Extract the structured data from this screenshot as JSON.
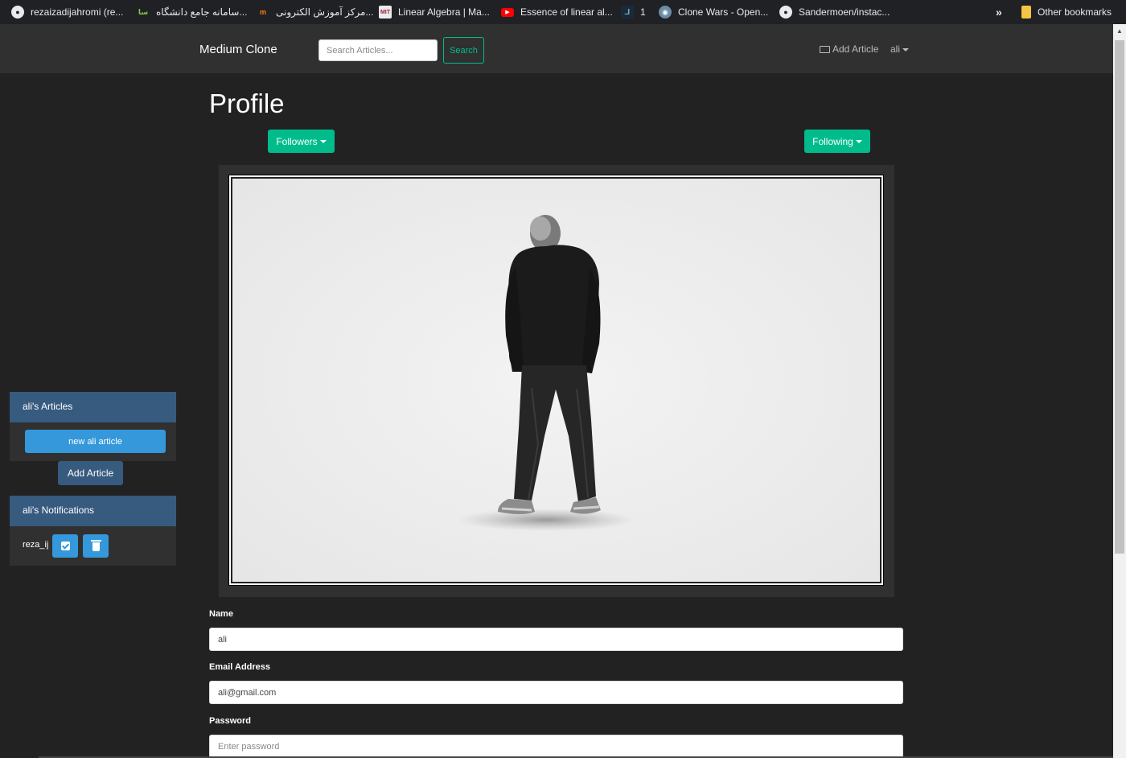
{
  "bookmarks": [
    {
      "label": "rezaizadijahromi (re...",
      "icon": "github-icon"
    },
    {
      "label": "سامانه جامع دانشگاه...",
      "icon": "university-icon",
      "badge": "سا"
    },
    {
      "label": "مرکز آموزش الکترونی...",
      "icon": "moodle-icon",
      "badge": "m"
    },
    {
      "label": "Linear Algebra | Ma...",
      "icon": "mit-ocw-icon",
      "badge": "MIT"
    },
    {
      "label": "Essence of linear al...",
      "icon": "youtube-icon",
      "badge": "▶"
    },
    {
      "label": "1",
      "icon": "app-icon",
      "badge": "لـ"
    },
    {
      "label": "Clone Wars - Open...",
      "icon": "globe-icon"
    },
    {
      "label": "Sandermoen/instac...",
      "icon": "github-icon"
    },
    {
      "label": "»",
      "icon": "more-icon"
    },
    {
      "label": "Other bookmarks",
      "icon": "folder-icon"
    }
  ],
  "navbar": {
    "brand": "Medium Clone",
    "search_placeholder": "Search Articles...",
    "search_button": "Search",
    "add_article": "Add Article",
    "user": "ali"
  },
  "profile": {
    "title": "Profile",
    "followers_button": "Followers",
    "following_button": "Following"
  },
  "form": {
    "name_label": "Name",
    "name_value": "ali",
    "email_label": "Email Address",
    "email_value": "ali@gmail.com",
    "password_label": "Password",
    "password_placeholder": "Enter password"
  },
  "sidebar": {
    "articles_header": "ali's Articles",
    "article_item": "new ali article",
    "add_article_button": "Add Article",
    "notifications_header": "ali's Notifications",
    "notification_user": "reza_ij"
  },
  "colors": {
    "background": "#222222",
    "navbar": "#303030",
    "accent_green": "#00bc8c",
    "primary": "#375a7f",
    "info": "#3498db"
  }
}
